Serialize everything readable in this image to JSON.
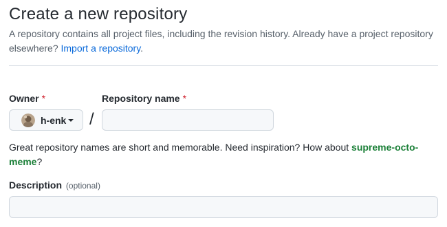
{
  "header": {
    "title": "Create a new repository",
    "subtitle_text": "A repository contains all project files, including the revision history. Already have a project repository elsewhere?",
    "import_link": "Import a repository",
    "import_suffix": "."
  },
  "owner": {
    "label": "Owner",
    "required_mark": "*",
    "selected": "h-enk",
    "icon": "chevron-down-icon"
  },
  "separator": "/",
  "repo_name": {
    "label": "Repository name",
    "required_mark": "*",
    "value": "",
    "placeholder": ""
  },
  "suggestion": {
    "prefix": "Great repository names are short and memorable. Need inspiration? How about",
    "name": "supreme-octo-meme",
    "suffix": "?"
  },
  "description": {
    "label": "Description",
    "optional": "(optional)",
    "value": "",
    "placeholder": ""
  },
  "colors": {
    "link": "#0969da",
    "required": "#cf222e",
    "suggestion": "#1a7f37",
    "input_bg": "#f6f8fa",
    "border": "#d0d7de"
  }
}
